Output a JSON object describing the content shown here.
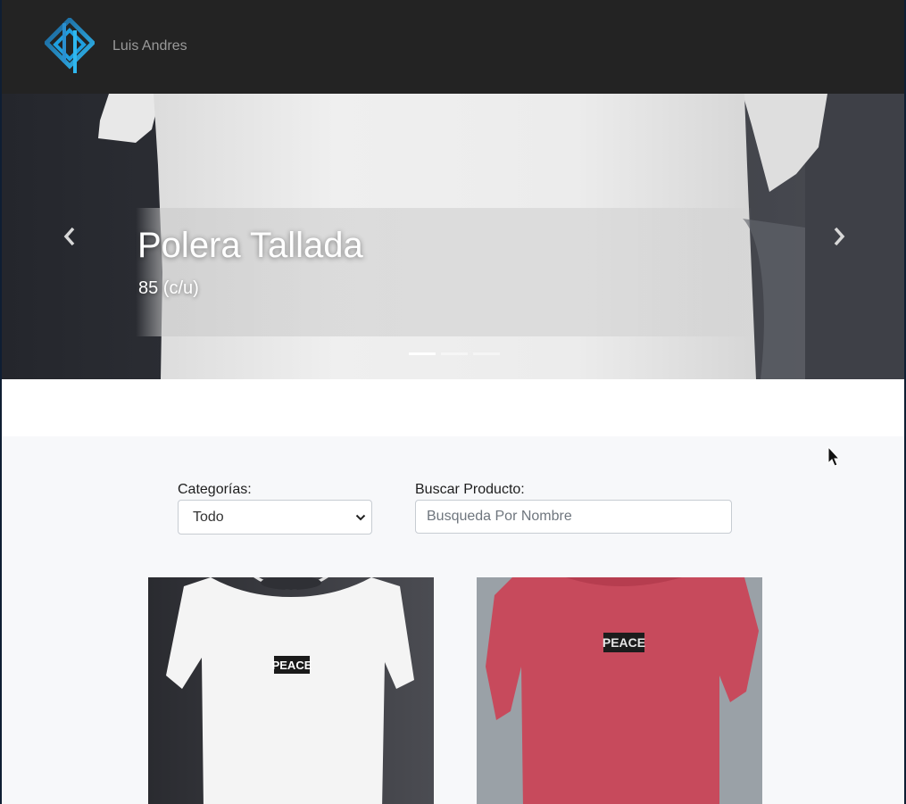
{
  "navbar": {
    "brand_name": "Luis Andres",
    "logo_icon": "diamond-logo-icon"
  },
  "carousel": {
    "slide_title": "Polera Tallada",
    "slide_price": "85 (c/u)",
    "prev_icon": "chevron-left-icon",
    "next_icon": "chevron-right-icon",
    "slide_count": 3,
    "active_slide": 1
  },
  "filters": {
    "category_label": "Categorías:",
    "category_selected": "Todo",
    "search_label": "Buscar Producto:",
    "search_placeholder": "Busqueda Por Nombre",
    "search_value": ""
  },
  "products": [
    {
      "color_name": "white",
      "print_text": "PEACE"
    },
    {
      "color_name": "red",
      "print_text": "PEACE"
    }
  ],
  "colors": {
    "navbar_bg": "#232323",
    "logo_blue": "#1e9fe0",
    "section_bg": "#f7f8fa"
  }
}
